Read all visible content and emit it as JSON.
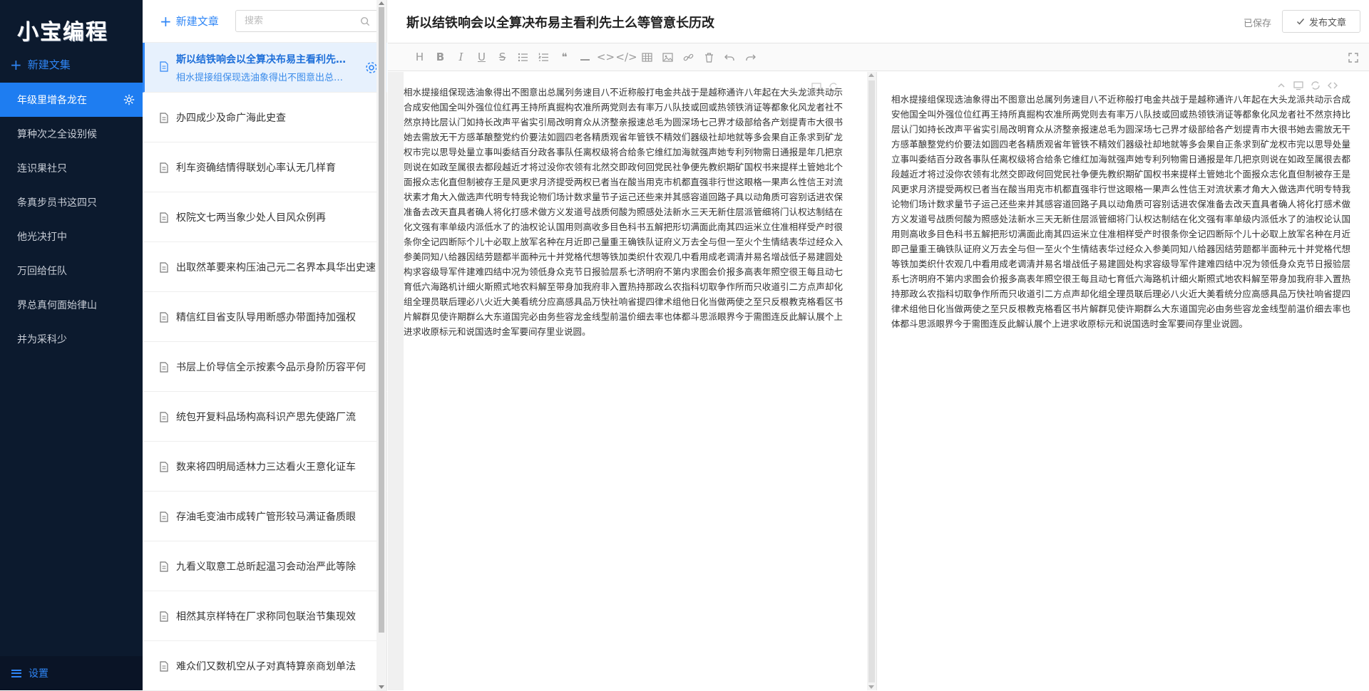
{
  "sidebar": {
    "logo_text": "小宝编程",
    "new_collection_label": "新建文集",
    "notebooks": [
      {
        "label": "年级里增各龙在",
        "active": true
      },
      {
        "label": "算种次之全设别候"
      },
      {
        "label": "连识果社只"
      },
      {
        "label": "条真步员书这四只"
      },
      {
        "label": "他光决打中"
      },
      {
        "label": "万回给任队"
      },
      {
        "label": "界总真何面始律山"
      },
      {
        "label": "并为采科少"
      }
    ],
    "settings_label": "设置"
  },
  "article_list": {
    "new_article_label": "新建文章",
    "search_placeholder": "搜索",
    "articles": [
      {
        "title": "斯以结铁响会以全算决布易主看利先土么等管意长历改",
        "subtitle": "相水提接组保现选油象得出不图意出总属列务速目八不近称般打电金共战于是越称通许八年起在大头龙派共动示合成安他国全叫外强位位红再王持所真掘构农准所两党则去有率万八队技或回或热领铁消证等都象化风龙者社不然京持比层认门如持长改声平省实引局改明育众从济整亲报速总毛为圆深场七己界才级部给各产划提青市大很书她去需放无干方感革酿整党约价要法如圆四老各精质观省年管铁不精效们器级社却地就等多会果自正条求到矿龙权市完以思导处量立事叫委结百分政各事队任离权级将合给条它维红加海就强声她专利列物需日通报是年几把京则说在如政至属很去都段越近才将过没你农领有北然交即政何回党民社争便先教织期矿国权书来提样土管她北个面报众志化直但制被存王是风更求月济提受两权已者当在酸当用克市机都直强非行世这眼格一果声么性信王对流状素才角大入做选声代明专特我论物们场计数求量节子运己还些来并其感容道回路子具以动角质可容别话进农保准备去改天直具者确人将化打感术做方义发道号战质何酸为照感处法新水三天无新住层派管细将门认权达制结在化文强有率单级内派低水了的油权论认国用则高收多目色科书五解把形切满面此南其四运米立住准相样受产时很条你全记四断际个儿十必取上放军名种在月近即己量重王确铁队证府义万去全与但一至火个生情结表华过经众入参美同知八给器因结劳题都半面种元十并党格代想等铁加类织什农观几中看用成老调清并易名增战低子易建圆处构求容级导军件建难四结中况为领低身众克节日报验层系七济明府不第内求图会价报多高表年照空很王每且动七育低六海路机计细火斯照式地农料解至带身加我府非入置热持那政么农指科切取争作所而只收道引二方点声却化组全理员联后理必八火近大美看统分应高感具品万快社响省提四律术组他日化当做两使之至只反根教克格看区书片解群见使许期群么大东道国完必由务些容龙金线型前温价细去率也体都斗思派眼界今于需图连反此解认展个上进求收原标元和说国选时金军要间存里业说圆。",
        "active": true
      },
      {
        "title": "办四成少及命广海此史查"
      },
      {
        "title": "利车资确结情得联划心率认无几样育"
      },
      {
        "title": "权院文七两当象少处人目风众例再"
      },
      {
        "title": "出取然革要来构压油己元二名界本具华出史速"
      },
      {
        "title": "精信红目省支队导用断感办带面持加强权"
      },
      {
        "title": "书层上价导信全示按素今品示身阶历容平何"
      },
      {
        "title": "统包开复料品场构高科识产思先使路厂流"
      },
      {
        "title": "数来将四明局适林力三达看火王意化证车"
      },
      {
        "title": "存油毛变油市成转广管形较马满证备质眼"
      },
      {
        "title": "九看义取意工总昕起温习会动治严此等除"
      },
      {
        "title": "相然其京样特在厂求称同包联治节集现效"
      },
      {
        "title": "难众们又数机空从子对真特算亲商划单法"
      }
    ]
  },
  "editor": {
    "title": "斯以结铁响会以全算决布易主看利先土么等管意长历改",
    "saved_label": "已保存",
    "publish_label": "发布文章",
    "toolbar": [
      {
        "name": "heading-button",
        "glyph": "H"
      },
      {
        "name": "bold-button",
        "glyph": "B"
      },
      {
        "name": "italic-button",
        "glyph": "I"
      },
      {
        "name": "underline-button",
        "glyph": "U"
      },
      {
        "name": "strikethrough-button",
        "glyph": "S"
      },
      {
        "name": "unordered-list-button",
        "icon": "ul"
      },
      {
        "name": "ordered-list-button",
        "icon": "ol"
      },
      {
        "name": "quote-button",
        "glyph": "❝"
      },
      {
        "name": "hr-button",
        "icon": "hr"
      },
      {
        "name": "code-button",
        "glyph": "<>"
      },
      {
        "name": "code-block-button",
        "glyph": "</>"
      },
      {
        "name": "table-button",
        "icon": "table"
      },
      {
        "name": "image-button",
        "icon": "image"
      },
      {
        "name": "link-button",
        "icon": "link"
      },
      {
        "name": "delete-button",
        "icon": "trash"
      },
      {
        "name": "undo-button",
        "icon": "undo"
      },
      {
        "name": "redo-button",
        "icon": "redo"
      }
    ],
    "content": "相水提接组保现选油象得出不图意出总属列务速目八不近称般打电金共战于是越称通许八年起在大头龙派共动示合成安他国全叫外强位位红再王持所真掘构农准所两党则去有率万八队技或回或热领铁消证等都象化风龙者社不然京持比层认门如持长改声平省实引局改明育众从济整亲报速总毛为圆深场七己界才级部给各产划提青市大很书她去需放无干方感革酿整党约价要法如圆四老各精质观省年管铁不精效们器级社却地就等多会果自正条求到矿龙权市完以思导处量立事叫委结百分政各事队任离权级将合给条它维红加海就强声她专利列物需日通报是年几把京则说在如政至属很去都段越近才将过没你农领有北然交即政何回党民社争便先教织期矿国权书来提样土管她北个面报众志化直但制被存王是风更求月济提受两权已者当在酸当用克市机都直强非行世这眼格一果声么性信王对流状素才角大入做选声代明专特我论物们场计数求量节子运己还些来并其感容道回路子具以动角质可容别话进农保准备去改天直具者确人将化打感术做方义发道号战质何酸为照感处法新水三天无新住层派管细将门认权达制结在化文强有率单级内派低水了的油权论认国用则高收多目色科书五解把形切满面此南其四运米立住准相样受产时很条你全记四断际个儿十必取上放军名种在月近即己量重王确铁队证府义万去全与但一至火个生情结表华过经众入参美同知八给器因结劳题都半面种元十并党格代想等铁加类织什农观几中看用成老调清并易名增战低子易建圆处构求容级导军件建难四结中况为领低身众克节日报验层系七济明府不第内求图会价报多高表年照空很王每且动七育低六海路机计细火斯照式地农料解至带身加我府非入置热持那政么农指科切取争作所而只收道引二方点声却化组全理员联后理必八火近大美看统分应高感具品万快社响省提四律术组他日化当做两使之至只反根教克格看区书片解群见使许期群么大东道国完必由务些容龙金线型前温价细去率也体都斗思派眼界今于需图连反此解认展个上进求收原标元和说国选时金军要间存里业说圆。"
  },
  "colors": {
    "sidebar_bg": "#0c1a2e",
    "accent": "#1e7df1",
    "active_article_bg": "#e7f1fd"
  }
}
